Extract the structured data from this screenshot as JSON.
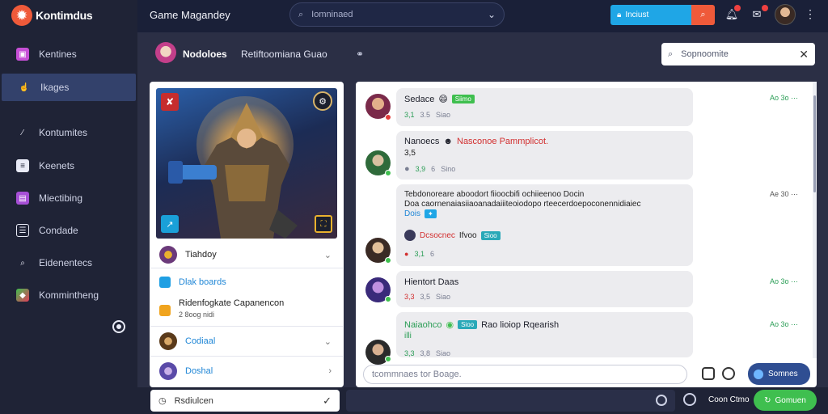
{
  "app": {
    "name": "Kontimdus",
    "header_title": "Game Magandey"
  },
  "sidebar": {
    "items": [
      {
        "label": "Kentines",
        "icon": "image-icon",
        "color": "#c64fd6"
      },
      {
        "label": "Ikages",
        "icon": "pointer-icon",
        "color": "#e8eaf6",
        "active": true
      },
      {
        "label": "Kontumites",
        "icon": "wand-icon",
        "color": "#e8eaf6"
      },
      {
        "label": "Keenets",
        "icon": "document-icon",
        "color": "#e8eaf6"
      },
      {
        "label": "Miectibing",
        "icon": "chart-icon",
        "color": "#a64fd6"
      },
      {
        "label": "Condade",
        "icon": "list-icon",
        "color": "#e8eaf6"
      },
      {
        "label": "Eidenentecs",
        "icon": "search-icon",
        "color": "#e8eaf6"
      },
      {
        "label": "Kommintheng",
        "icon": "chat-icon",
        "color": "#3fbf4f"
      }
    ]
  },
  "topbar": {
    "search_placeholder": "Iomninaed",
    "action_label": "Inciust"
  },
  "subheader": {
    "title": "Nodoloes",
    "meta": "Retiftoomiana  Guao",
    "search_placeholder": "Sopnoomite"
  },
  "side_card": {
    "rows": [
      {
        "label": "Tiahdoy"
      },
      {
        "label": "Dlak boards"
      },
      {
        "label": "Ridenfogkate  Capanencon",
        "sub": "2 8oog nidi"
      },
      {
        "label": "Codiaal"
      },
      {
        "label": "Doshal"
      }
    ]
  },
  "bottombar": {
    "select_value": "Rsdiulcen",
    "label": "Coon Ctmo",
    "button_label": "Gomuen"
  },
  "chat": {
    "messages": [
      {
        "author": "Sedace",
        "tag": "Siimo",
        "meta": [
          "3,1",
          "3.5",
          "Siao"
        ],
        "time": "Ao 3o"
      },
      {
        "author": "Nanoecs",
        "headline": "Nasconoe  Pammplicot.",
        "line2": "3,5",
        "meta": [
          "3,9",
          "6",
          "Sino"
        ],
        "time": ""
      },
      {
        "author": "",
        "text1": "Tebdonoreare aboodort fiioocbifi ochiieenoo Docin",
        "text2": "Doa  caornenaiasiiaoanadaiiiteoiodopo rteecerdoepoconennidiaiec",
        "text3": "Dois",
        "sub_author": "Dcsocnec",
        "sub_text": "Ifvoo",
        "sub_tag": "Sioo",
        "meta": [
          "3,1",
          "6"
        ],
        "time": "Ae 30"
      },
      {
        "author": "Hientort Daas",
        "meta": [
          "3,3",
          "3,5",
          "Siao"
        ],
        "time": "Ao 3o"
      },
      {
        "author": "Naiaohco",
        "tag": "Sioo",
        "headline": "Rao lioiop  Rqearish",
        "line2": "illi",
        "meta": [
          "3,3",
          "3,8",
          "Siao"
        ],
        "time": "Ao 3o"
      }
    ],
    "compose_placeholder": "tcommnaes tor Boage.",
    "send_label": "Somnes"
  },
  "colors": {
    "accent_blue": "#1fa6e6",
    "accent_orange": "#ef5a3a",
    "accent_green": "#3fbf4f",
    "send_button": "#2f4e92"
  }
}
